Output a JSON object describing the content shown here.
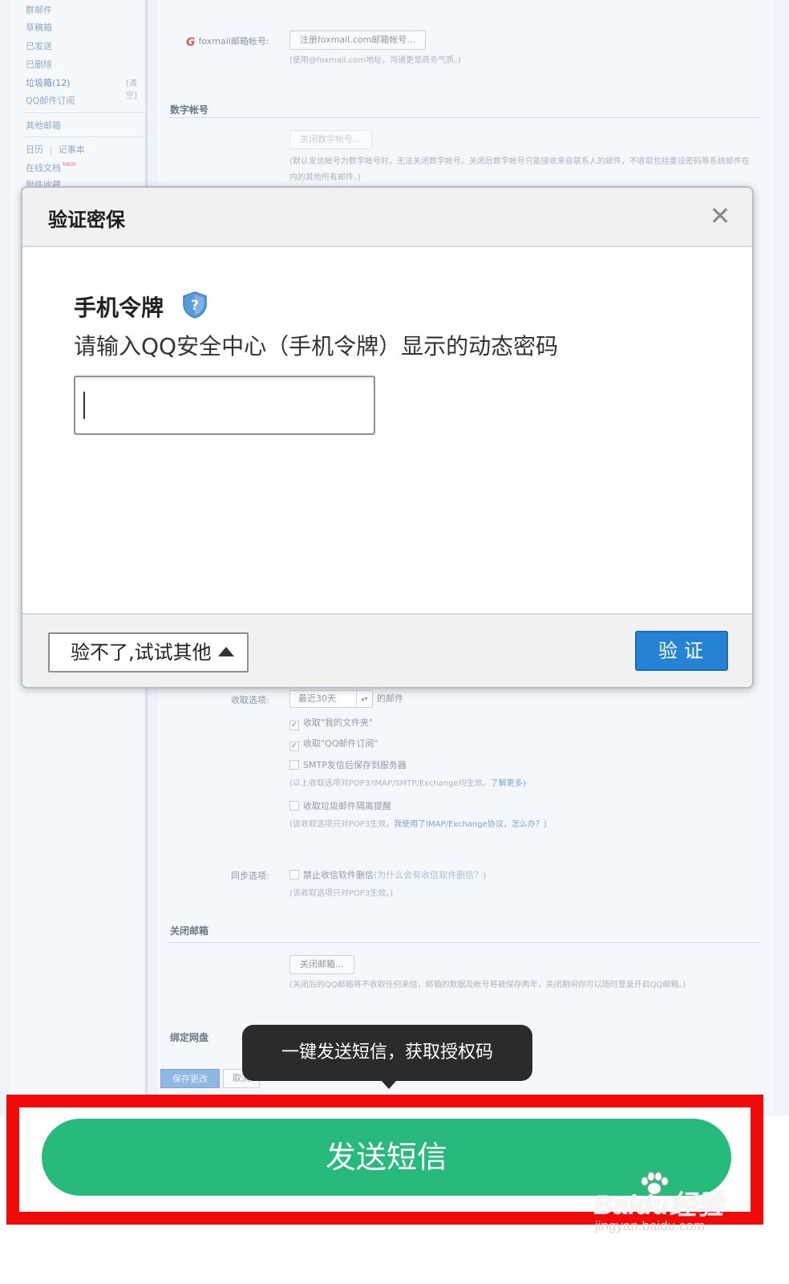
{
  "sidebar": {
    "items": [
      "群邮件",
      "草稿箱",
      "已发送",
      "已删除",
      "垃圾箱(12)",
      "QQ邮件订阅",
      "其他邮箱",
      "日历",
      "记事本",
      "在线文档",
      "附件收藏"
    ],
    "clear_label": "[清空]",
    "separator": "|",
    "new_badge": "NEW"
  },
  "settings": {
    "foxmail_label": "foxmail邮箱帐号:",
    "foxmail_button": "注册foxmail.com邮箱帐号...",
    "foxmail_hint": "(使用@foxmail.com地址，沟通更显商务气质。)",
    "digital_section": "数字帐号",
    "digital_button": "关闭数字帐号...",
    "digital_hint": "(默认发信帐号为数字帐号时，无法关闭数字帐号。关闭后数字帐号只能接收来自联系人的邮件，不收取包括重设密码等系统邮件在内的其他所有邮件。)",
    "receive_label": "收取选项:",
    "receive_select": "最近30天",
    "receive_suffix": "的邮件",
    "check_my_folder": "收取\"我的文件夹\"",
    "check_qq_subscribe": "收取\"QQ邮件订阅\"",
    "check_smtp_save": "SMTP发信后保存到服务器",
    "hint_protocols": "(以上收取选项对POP3/IMAP/SMTP/Exchange均生效。",
    "hint_protocols_link": "了解更多)",
    "check_spam_alert": "收取垃圾邮件隔离提醒",
    "hint_pop3": "(该收取选项只对POP3生效。",
    "hint_pop3_link": "我使用了IMAP/Exchange协议，怎么办？)",
    "sync_label": "同步选项:",
    "check_no_delete": "禁止收信软件删信",
    "check_no_delete_link": "(为什么会有收信软件删信？)",
    "sync_hint": "(该收取选项只对POP3生效。)",
    "close_section": "关闭邮箱",
    "close_button": "关闭邮箱...",
    "close_hint": "(关闭后的QQ邮箱将不收取任何来信，邮箱的数据及帐号将被保存两年，关闭期间你可以随时登录开启QQ邮箱。)",
    "netdisk_section": "绑定网盘",
    "save_button": "保存更改",
    "cancel_button": "取消"
  },
  "modal": {
    "title": "验证密保",
    "close_glyph": "✕",
    "token_title": "手机令牌",
    "description": "请输入QQ安全中心（手机令牌）显示的动态密码",
    "input_value": "",
    "other_button": "验不了,试试其他",
    "verify_button": "验证"
  },
  "tooltip": {
    "text": "一键发送短信，获取授权码"
  },
  "send_button": {
    "label": "发送短信"
  },
  "watermark": {
    "brand": "Baidu经验",
    "url": "jingyan.baidu.com"
  },
  "colors": {
    "send_green": "#28b97c",
    "verify_blue": "#2683d4",
    "highlight_red": "#f00a0a"
  }
}
